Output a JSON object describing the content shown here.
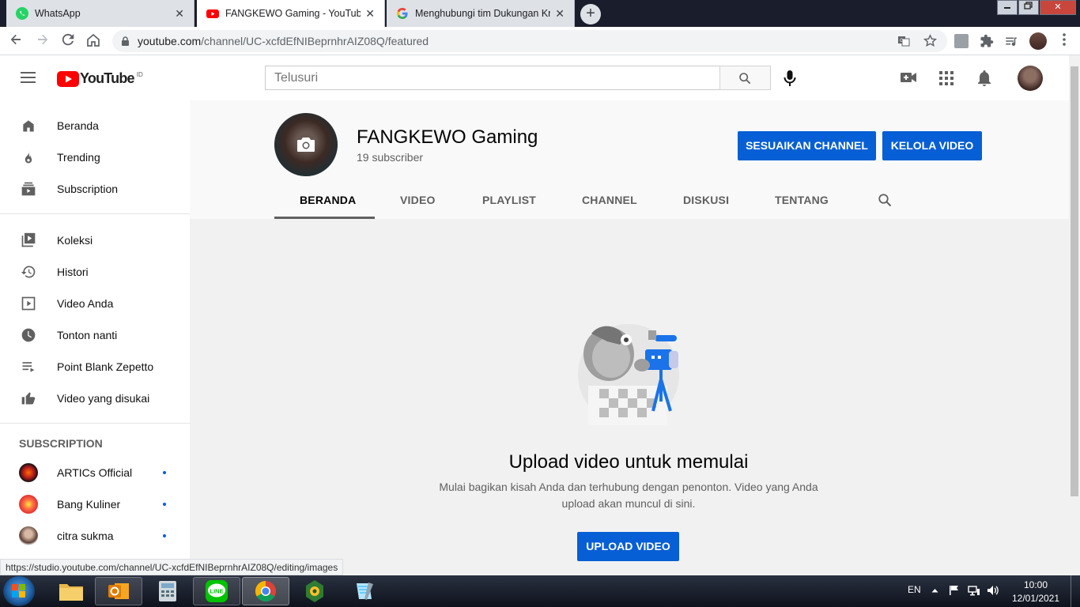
{
  "browser": {
    "tabs": [
      {
        "title": "WhatsApp",
        "icon": "whatsapp-icon",
        "active": false
      },
      {
        "title": "FANGKEWO Gaming - YouTube",
        "icon": "youtube-icon",
        "active": true
      },
      {
        "title": "Menghubungi tim Dukungan Kre",
        "icon": "google-icon",
        "active": false
      }
    ],
    "close_glyph": "✕",
    "new_tab_glyph": "+",
    "url_host": "youtube.com",
    "url_path": "/channel/UC-xcfdEfNIBeprnhrAIZ08Q/featured",
    "status_url": "https://studio.youtube.com/channel/UC-xcfdEfNIBeprnhrAIZ08Q/editing/images"
  },
  "youtube": {
    "logo_text": "YouTube",
    "country_code": "ID",
    "search_placeholder": "Telusuri",
    "sidebar": {
      "main": [
        {
          "label": "Beranda",
          "icon": "home-icon"
        },
        {
          "label": "Trending",
          "icon": "fire-icon"
        },
        {
          "label": "Subscription",
          "icon": "subscriptions-icon"
        }
      ],
      "library": [
        {
          "label": "Koleksi",
          "icon": "library-icon"
        },
        {
          "label": "Histori",
          "icon": "history-icon"
        },
        {
          "label": "Video Anda",
          "icon": "your-videos-icon"
        },
        {
          "label": "Tonton nanti",
          "icon": "watch-later-icon"
        },
        {
          "label": "Point Blank Zepetto",
          "icon": "playlist-icon"
        },
        {
          "label": "Video yang disukai",
          "icon": "like-icon"
        }
      ],
      "subscription_heading": "SUBSCRIPTION",
      "subscriptions": [
        {
          "label": "ARTICs Official"
        },
        {
          "label": "Bang Kuliner"
        },
        {
          "label": "citra sukma"
        }
      ]
    },
    "channel": {
      "name": "FANGKEWO Gaming",
      "subscribers": "19 subscriber",
      "customize_button": "SESUAIKAN CHANNEL",
      "manage_button": "KELOLA VIDEO",
      "tabs": [
        "BERANDA",
        "VIDEO",
        "PLAYLIST",
        "CHANNEL",
        "DISKUSI",
        "TENTANG"
      ],
      "active_tab": "BERANDA"
    },
    "empty_state": {
      "title": "Upload video untuk memulai",
      "description_line1": "Mulai bagikan kisah Anda dan terhubung dengan penonton. Video yang Anda",
      "description_line2": "upload akan muncul di sini.",
      "upload_button": "UPLOAD VIDEO"
    },
    "colors": {
      "brand_red": "#ff0000",
      "accent_blue": "#065fd4"
    }
  },
  "taskbar": {
    "language": "EN",
    "time": "10:00",
    "date": "12/01/2021"
  }
}
